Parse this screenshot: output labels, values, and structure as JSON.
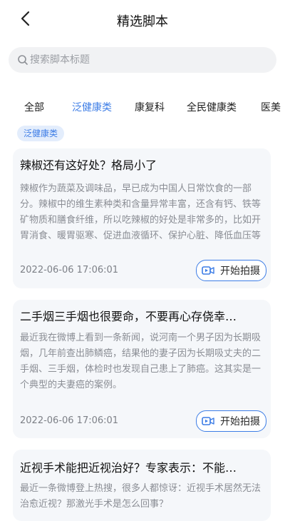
{
  "nav": {
    "title": "精选脚本"
  },
  "search": {
    "placeholder": "搜索脚本标题"
  },
  "tabs": [
    {
      "label": "全部",
      "active": false
    },
    {
      "label": "泛健康类",
      "active": true
    },
    {
      "label": "康复科",
      "active": false
    },
    {
      "label": "全民健康类",
      "active": false
    },
    {
      "label": "医美",
      "active": false
    }
  ],
  "chip": {
    "label": "泛健康类"
  },
  "articles": [
    {
      "title": "辣椒还有这好处？格局小了",
      "excerpt": "辣椒作为蔬菜及调味品，早已成为中国人日常饮食的一部分。辣椒中的维生素种类和含量异常丰富，还含有钙、铁等矿物质和膳食纤维，所以吃辣椒的好处是非常多的，比如开胃消食、暖胃驱寒、促进血液循环、保护心脏、降低血压等等。另外辣椒中独特的…",
      "date": "2022-06-06 17:06:01",
      "button": "开始拍摄"
    },
    {
      "title": "二手烟三手烟也很要命，不要再心存侥幸…",
      "excerpt": "最近我在微博上看到一条新闻，说河南一个男子因为长期吸烟，几年前查出肺鳞癌，结果他的妻子因为长期吸丈夫的二手烟、三手烟，体检时也发现自己患上了肺癌。这其实是一个典型的夫妻癌的案例。\n世界卫生组织研究指出，长期吸二手烟患肺癌的风…",
      "date": "2022-06-06 17:06:01",
      "button": "开始拍摄"
    },
    {
      "title": "近视手术能把近视治好？专家表示：不能…",
      "excerpt": "最近一条微博登上热搜，很多人都惊讶：近视手术居然无法治愈近视？那激光手术是怎么回事？",
      "date": "",
      "button": ""
    }
  ],
  "colors": {
    "accent": "#3d7de6",
    "card_bg": "#f5f7fa",
    "chip_bg": "#e3edfc"
  }
}
